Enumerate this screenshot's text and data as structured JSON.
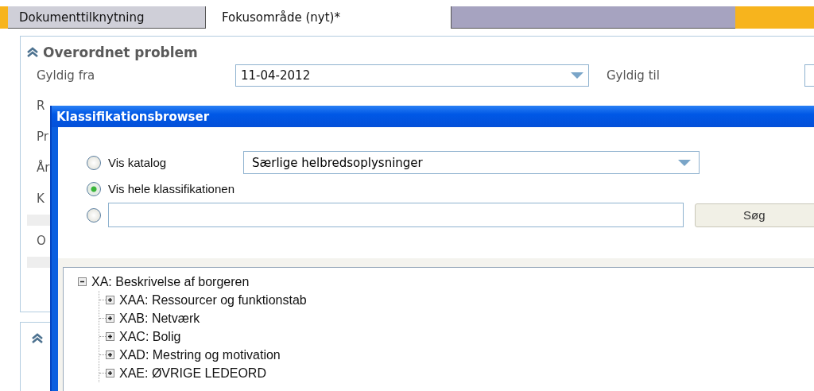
{
  "tabs": [
    {
      "label": "Dokumenttilknytning",
      "selected": false
    },
    {
      "label": "Fokusområde (nyt)*",
      "selected": true
    }
  ],
  "panel": {
    "title": "Overordnet problem",
    "expanded": true,
    "valid_from_label": "Gyldig fra",
    "valid_from_value": "11-04-2012",
    "valid_to_label": "Gyldig til",
    "cut_labels": [
      "R",
      "Pr",
      "År",
      "K",
      "O"
    ]
  },
  "second_panel": {
    "expanded": true
  },
  "dialog": {
    "title": "Klassifikationsbrowser",
    "options": [
      {
        "kind": "dropdown",
        "label": "Vis katalog",
        "selected": false,
        "value": "Særlige helbredsoplysninger"
      },
      {
        "kind": "plain",
        "label": "Vis hele klassifikationen",
        "selected": true
      },
      {
        "kind": "search",
        "selected": false,
        "button": "Søg"
      }
    ],
    "tree": [
      {
        "label": "XA: Beskrivelse af borgeren",
        "expanded": true,
        "children": [
          {
            "label": "XAA: Ressourcer og funktionstab",
            "expanded": false
          },
          {
            "label": "XAB: Netværk",
            "expanded": false
          },
          {
            "label": "XAC: Bolig",
            "expanded": false
          },
          {
            "label": "XAD: Mestring og motivation",
            "expanded": false
          },
          {
            "label": "XAE: ØVRIGE LEDEORD",
            "expanded": false
          }
        ]
      }
    ]
  }
}
